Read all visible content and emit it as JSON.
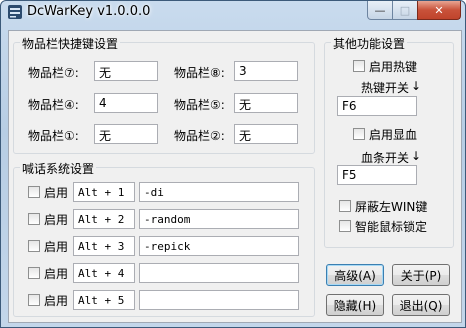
{
  "window": {
    "title": "DcWarKey v1.0.0.0",
    "controls": {
      "minimize": "—",
      "maximize": "□",
      "close": "✕"
    }
  },
  "item_hotkeys": {
    "label": "物品栏快捷键设置",
    "slots": [
      {
        "label": "物品栏⑦:",
        "value": "无"
      },
      {
        "label": "物品栏⑧:",
        "value": "3"
      },
      {
        "label": "物品栏④:",
        "value": "4"
      },
      {
        "label": "物品栏⑤:",
        "value": "无"
      },
      {
        "label": "物品栏①:",
        "value": "无"
      },
      {
        "label": "物品栏②:",
        "value": "无"
      }
    ]
  },
  "shout_settings": {
    "label": "喊话系统设置",
    "rows": [
      {
        "enable": "启用",
        "key": "Alt + 1",
        "text": "-di"
      },
      {
        "enable": "启用",
        "key": "Alt + 2",
        "text": "-random"
      },
      {
        "enable": "启用",
        "key": "Alt + 3",
        "text": "-repick"
      },
      {
        "enable": "启用",
        "key": "Alt + 4",
        "text": ""
      },
      {
        "enable": "启用",
        "key": "Alt + 5",
        "text": ""
      }
    ]
  },
  "other_functions": {
    "label": "其他功能设置",
    "enable_hotkey": "启用热键",
    "hotkey_toggle_label": "热键开关",
    "hotkey_toggle_value": "F6",
    "enable_hp": "启用显血",
    "hpbar_toggle_label": "血条开关",
    "hpbar_toggle_value": "F5",
    "block_win": "屏蔽左WIN键",
    "smart_mouse": "智能鼠标锁定",
    "arrow": "↓"
  },
  "buttons": {
    "advanced": "高级(A)",
    "about": "关于(P)",
    "hide": "隐藏(H)",
    "exit": "退出(Q)"
  }
}
